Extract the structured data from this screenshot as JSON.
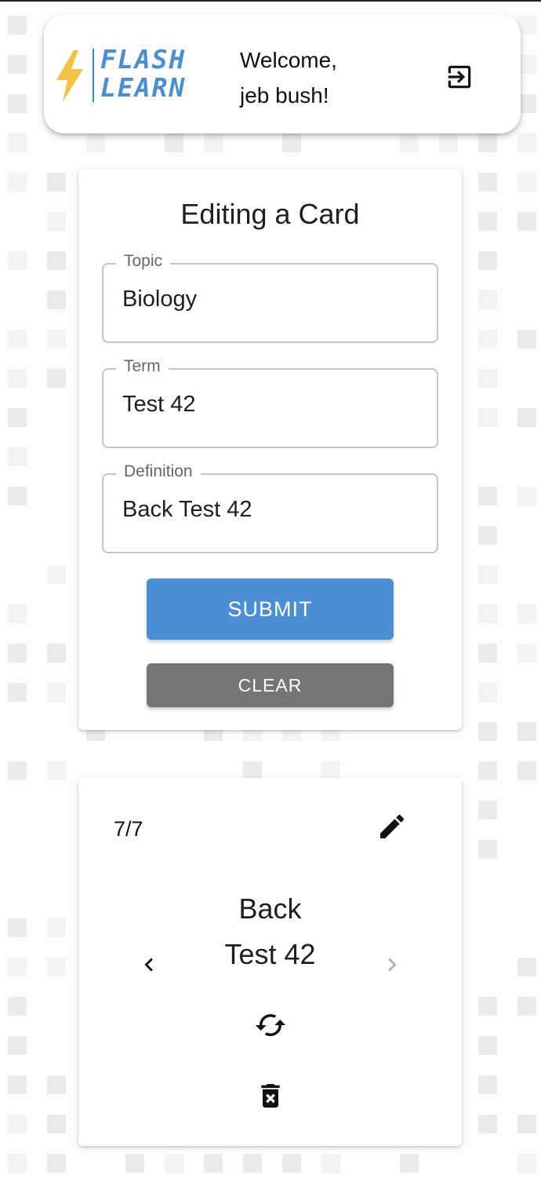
{
  "header": {
    "logo_text_line1": "FLASH",
    "logo_text_line2": "LEARN",
    "welcome_line1": "Welcome,",
    "welcome_line2": "jeb bush!",
    "logout_icon": "logout-icon"
  },
  "edit_form": {
    "title": "Editing a Card",
    "fields": [
      {
        "label": "Topic",
        "value": "Biology"
      },
      {
        "label": "Term",
        "value": "Test 42"
      },
      {
        "label": "Definition",
        "value": "Back Test 42"
      }
    ],
    "submit_label": "SUBMIT",
    "clear_label": "CLEAR"
  },
  "viewer": {
    "counter": "7/7",
    "card_text_line1": "Back",
    "card_text_line2": "Test 42",
    "icons": [
      "edit-icon",
      "chevron-left-icon",
      "chevron-right-icon",
      "flip-icon",
      "delete-icon"
    ]
  },
  "colors": {
    "accent": "#4a8fd6",
    "clear_button": "#757575",
    "logo_bolt": "#f5c242",
    "disabled_icon": "#b0b0b0"
  }
}
